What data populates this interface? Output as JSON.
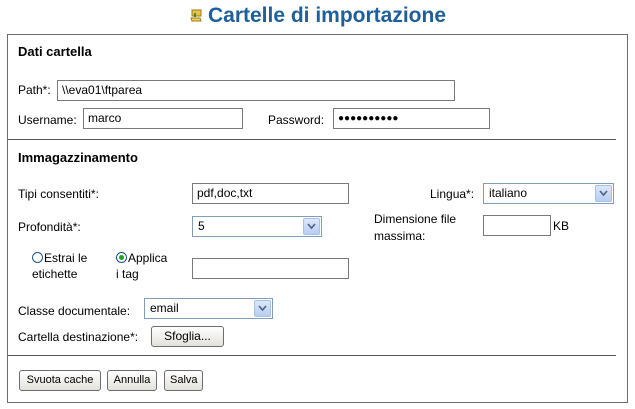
{
  "title": "Cartelle di importazione",
  "dati": {
    "heading": "Dati cartella",
    "path_label": "Path*:",
    "path_value": "\\\\eva01\\ftparea",
    "username_label": "Username:",
    "username_value": "marco",
    "password_label": "Password:",
    "password_value": "●●●●●●●●●●"
  },
  "immagazzinamento": {
    "heading": "Immagazzinamento",
    "tipi_label": "Tipi consentiti*:",
    "tipi_value": "pdf,doc,txt",
    "lingua_label": "Lingua*:",
    "lingua_value": "italiano",
    "profondita_label": "Profondità*:",
    "profondita_value": "5",
    "dim_label_1": "Dimensione file",
    "dim_label_2": "massima:",
    "dim_value": "",
    "dim_unit": "KB",
    "radio_estrai_1": "Estrai le",
    "radio_estrai_2": "etichette",
    "radio_applica_1": "Applica",
    "radio_applica_2": "i tag",
    "tag_value": "",
    "classe_label": "Classe documentale:",
    "classe_value": "email",
    "dest_label": "Cartella destinazione*:",
    "sfoglia_label": "Sfoglia..."
  },
  "buttons": {
    "svuota": "Svuota cache",
    "annulla": "Annulla",
    "salva": "Salva"
  }
}
